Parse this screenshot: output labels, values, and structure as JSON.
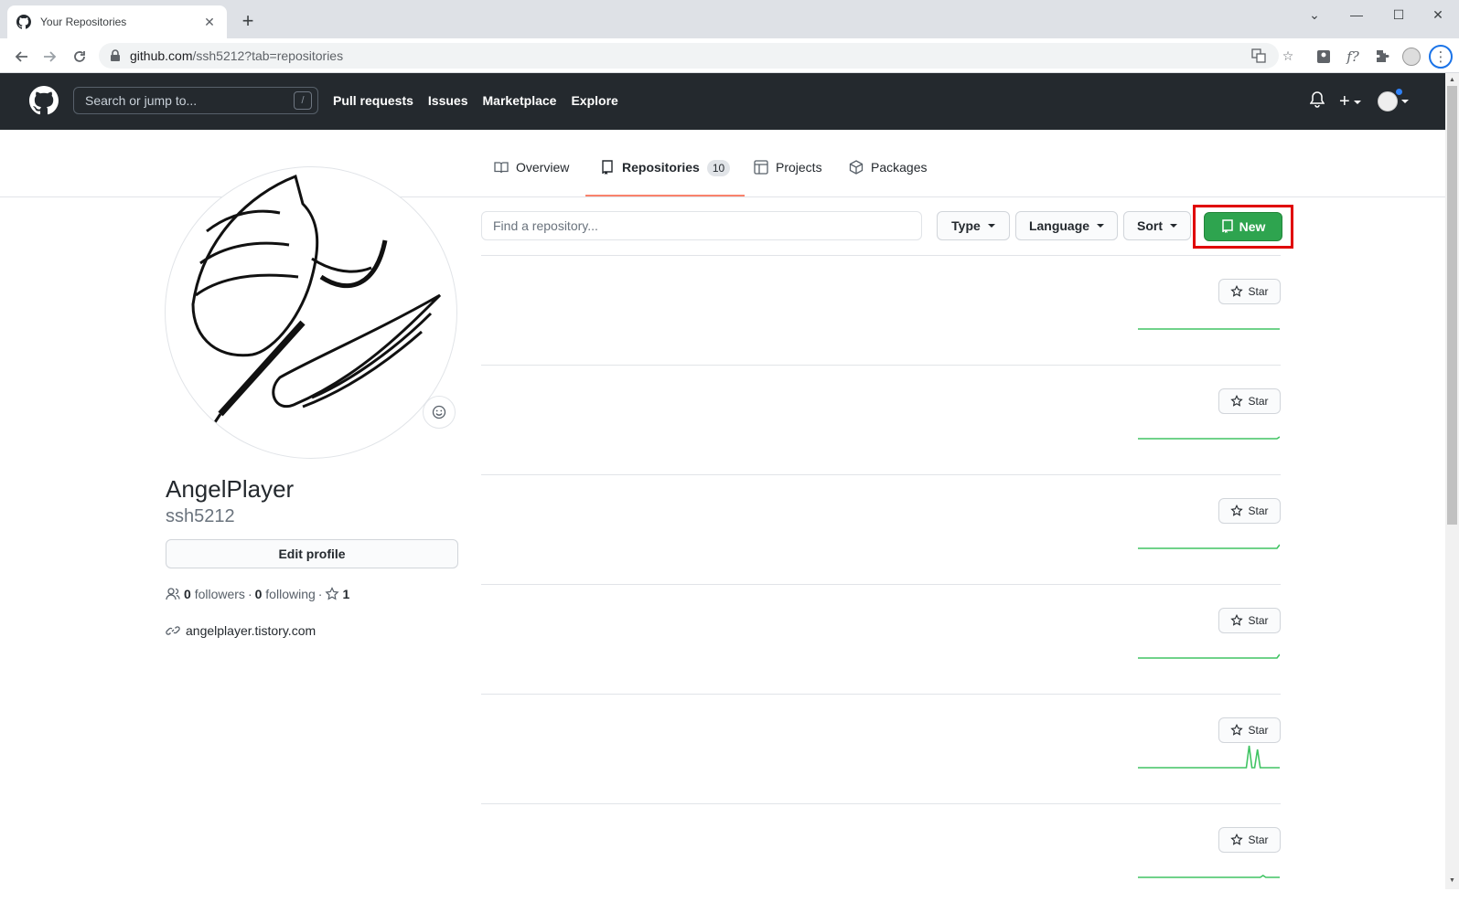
{
  "browser": {
    "tab_title": "Your Repositories",
    "url_host": "github.com",
    "url_rest": "/ssh5212?tab=repositories"
  },
  "header": {
    "search_placeholder": "Search or jump to...",
    "search_shortcut": "/",
    "nav": [
      "Pull requests",
      "Issues",
      "Marketplace",
      "Explore"
    ]
  },
  "profile_tabs": [
    {
      "label": "Overview",
      "icon": "book-icon"
    },
    {
      "label": "Repositories",
      "icon": "repo-icon",
      "count": "10",
      "selected": true
    },
    {
      "label": "Projects",
      "icon": "project-icon"
    },
    {
      "label": "Packages",
      "icon": "package-icon"
    }
  ],
  "profile": {
    "name": "AngelPlayer",
    "login": "ssh5212",
    "edit_label": "Edit profile",
    "followers_count": "0",
    "followers_label": "followers",
    "following_count": "0",
    "following_label": "following",
    "stars_count": "1",
    "website": "angelplayer.tistory.com"
  },
  "repos_toolbar": {
    "search_placeholder": "Find a repository...",
    "type_label": "Type",
    "language_label": "Language",
    "sort_label": "Sort",
    "new_label": "New"
  },
  "repos": [
    {
      "star_label": "Star",
      "activity": [
        0,
        0,
        0,
        0,
        0,
        0,
        0,
        0,
        0,
        0,
        0,
        0,
        0,
        0,
        0,
        0,
        0,
        0,
        0,
        0,
        0,
        0,
        0,
        0,
        0,
        0,
        0,
        0,
        0,
        0,
        0,
        0,
        0,
        0,
        0,
        0,
        0,
        0,
        0,
        0,
        0,
        0,
        0,
        0,
        0,
        0,
        0,
        0,
        0,
        0,
        0,
        0
      ]
    },
    {
      "star_label": "Star",
      "activity": [
        0,
        0,
        0,
        0,
        0,
        0,
        0,
        0,
        0,
        0,
        0,
        0,
        0,
        0,
        0,
        0,
        0,
        0,
        0,
        0,
        0,
        0,
        0,
        0,
        0,
        0,
        0,
        0,
        0,
        0,
        0,
        0,
        0,
        0,
        0,
        0,
        0,
        0,
        0,
        0,
        0,
        0,
        0,
        0,
        0,
        0,
        0,
        0,
        0,
        0,
        0,
        1
      ]
    },
    {
      "star_label": "Star",
      "activity": [
        0,
        0,
        0,
        0,
        0,
        0,
        0,
        0,
        0,
        0,
        0,
        0,
        0,
        0,
        0,
        0,
        0,
        0,
        0,
        0,
        0,
        0,
        0,
        0,
        0,
        0,
        0,
        0,
        0,
        0,
        0,
        0,
        0,
        0,
        0,
        0,
        0,
        0,
        0,
        0,
        0,
        0,
        0,
        0,
        0,
        0,
        0,
        0,
        0,
        0,
        0,
        2
      ]
    },
    {
      "star_label": "Star",
      "activity": [
        0,
        0,
        0,
        0,
        0,
        0,
        0,
        0,
        0,
        0,
        0,
        0,
        0,
        0,
        0,
        0,
        0,
        0,
        0,
        0,
        0,
        0,
        0,
        0,
        0,
        0,
        0,
        0,
        0,
        0,
        0,
        0,
        0,
        0,
        0,
        0,
        0,
        0,
        0,
        0,
        0,
        0,
        0,
        0,
        0,
        0,
        0,
        0,
        0,
        0,
        0,
        2
      ]
    },
    {
      "star_label": "Star",
      "activity": [
        0,
        0,
        0,
        0,
        0,
        0,
        0,
        0,
        0,
        0,
        0,
        0,
        0,
        0,
        0,
        0,
        0,
        0,
        0,
        0,
        0,
        0,
        0,
        0,
        0,
        0,
        0,
        0,
        0,
        0,
        0,
        0,
        0,
        0,
        0,
        0,
        0,
        0,
        0,
        0,
        12,
        0,
        0,
        10,
        0,
        0,
        0,
        0,
        0,
        0,
        0,
        0
      ]
    },
    {
      "star_label": "Star",
      "activity": [
        0,
        0,
        0,
        0,
        0,
        0,
        0,
        0,
        0,
        0,
        0,
        0,
        0,
        0,
        0,
        0,
        0,
        0,
        0,
        0,
        0,
        0,
        0,
        0,
        0,
        0,
        0,
        0,
        0,
        0,
        0,
        0,
        0,
        0,
        0,
        0,
        0,
        0,
        0,
        0,
        0,
        0,
        0,
        0,
        0,
        1,
        0,
        0,
        0,
        0,
        0,
        0
      ]
    }
  ]
}
